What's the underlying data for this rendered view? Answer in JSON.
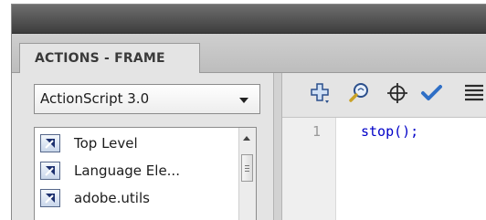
{
  "panel": {
    "tab_label": "ACTIONS - FRAME"
  },
  "language_select": {
    "value": "ActionScript 3.0"
  },
  "toolbox": {
    "items": [
      {
        "label": "Top Level",
        "icon": "package-icon"
      },
      {
        "label": "Language Ele...",
        "icon": "package-icon"
      },
      {
        "label": "adobe.utils",
        "icon": "package-icon"
      }
    ]
  },
  "toolbar": {
    "buttons": [
      {
        "name": "add-statement-button",
        "icon": "plus-icon"
      },
      {
        "name": "find-button",
        "icon": "magnifier-icon"
      },
      {
        "name": "insert-target-path-button",
        "icon": "crosshair-icon"
      },
      {
        "name": "check-syntax-button",
        "icon": "checkmark-icon"
      },
      {
        "name": "auto-format-button",
        "icon": "lines-icon"
      }
    ]
  },
  "editor": {
    "lines": [
      {
        "number": "1",
        "code": "stop();"
      }
    ]
  },
  "colors": {
    "code_keyword": "#0000c8",
    "line_number": "#9a9a9a",
    "panel_bg": "#e4e4e4",
    "title_bar": "#3d3d3d"
  }
}
